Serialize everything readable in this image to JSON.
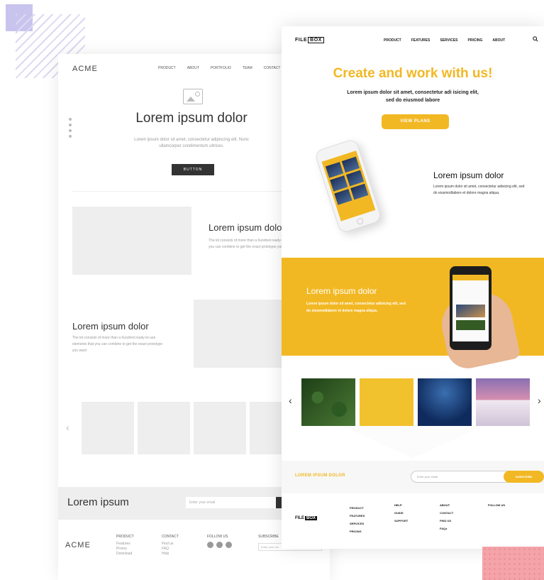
{
  "wireframe": {
    "logo": "ACME",
    "nav": [
      "PRODUCT",
      "ABOUT",
      "PORTFOLIO",
      "TEAM",
      "CONTACT"
    ],
    "hero": {
      "title": "Lorem ipsum dolor",
      "subtitle": "Lorem ipsum dolor sit amet, consectetur adipiscing elit. Nunc ullamcorper condimentum ultrices.",
      "button": "BUTTON"
    },
    "feature1": {
      "title": "Lorem ipsum dolor",
      "text": "The kit consists of more than a hundred ready-to-use elements that you can combine to get the exact prototype you want"
    },
    "feature2": {
      "title": "Lorem ipsum dolor",
      "text": "The kit consists of more than a hundred ready-to-use elements that you can combine to get the exact prototype you want"
    },
    "gallery_prev": "‹",
    "newsletter": {
      "title": "Lorem ipsum",
      "placeholder": "Enter your email"
    },
    "footer": {
      "logo": "ACME",
      "col1": {
        "heading": "PRODUCT",
        "items": [
          "Features",
          "Promo",
          "Download"
        ]
      },
      "col2": {
        "heading": "CONTACT",
        "items": [
          "Find us",
          "FAQ",
          "Help"
        ]
      },
      "col3": {
        "heading": "FOLLOW US"
      },
      "col4": {
        "heading": "SUBSCRIBE",
        "placeholder": "Enter your em"
      }
    }
  },
  "filebox": {
    "brand_text": "FILE",
    "brand_box": "BOX",
    "nav": [
      "PRODUCT",
      "FEATURES",
      "SERVICES",
      "PRICING",
      "ABOUT"
    ],
    "hero": {
      "title": "Create and work with us!",
      "subtitle": "Lorem ipsum dolor sit amet, consectetur adi isicing elit, sed do eiusmod labore",
      "cta": "VIEW PLANS"
    },
    "feature1": {
      "title": "Lorem ipsum dolor",
      "text": "Lorem ipsum dolor sit amet, consectetur adisicing elit, sed do eiusmodlabore et dolore magna aliqua."
    },
    "feature2": {
      "title": "Lorem ipsum dolor",
      "text": "Lorem ipsum dolor sit amet, consectetur adisicing elit, sed do eiusmodlabore et dolore magna aliqua."
    },
    "gallery_prev": "‹",
    "gallery_next": "›",
    "newsletter": {
      "title": "LOREM IPSUM DOLOR",
      "placeholder": "Enter your email",
      "button": "SUBSCRIBE"
    },
    "footer": {
      "brand_text": "FILE",
      "brand_box": "BOX",
      "col1": [
        "PRODUCT",
        "FEATURES",
        "SERVICES",
        "PRICING"
      ],
      "col2": {
        "heading": "HELP",
        "items": [
          "GUIDE",
          "SUPPORT"
        ]
      },
      "col3": {
        "heading": "ABOUT",
        "items": [
          "CONTACT",
          "FIND US",
          "FAQs"
        ]
      },
      "col4": {
        "heading": "FOLLOW US"
      }
    }
  },
  "colors": {
    "accent": "#f2b824",
    "wire_dark": "#333333",
    "wire_placeholder": "#eeeeee",
    "deco_purple": "#c9c4ee",
    "deco_pink": "#f4a3a8"
  }
}
